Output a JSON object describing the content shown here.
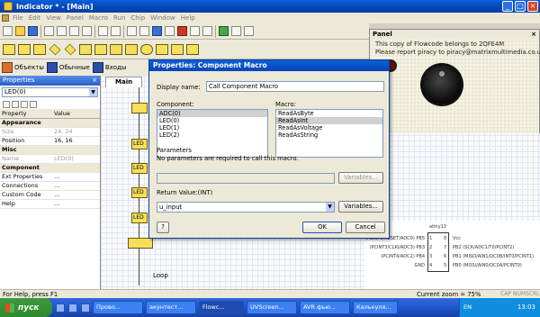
{
  "window": {
    "title": "Indicator * - [Main]"
  },
  "menu": [
    "File",
    "Edit",
    "View",
    "Panel",
    "Macro",
    "Run",
    "Chip",
    "Window",
    "Help"
  ],
  "toolbar3": {
    "objects": "Объекты",
    "common": "Обычные",
    "inputs": "Входы"
  },
  "properties": {
    "title": "Properties",
    "selected": "LED(0)",
    "col_property": "Property",
    "col_value": "Value",
    "rows": [
      {
        "type": "cat",
        "k": "Appearance",
        "v": ""
      },
      {
        "type": "dim",
        "k": "Size",
        "v": "24, 24"
      },
      {
        "type": "norm",
        "k": "Position",
        "v": "16, 16"
      },
      {
        "type": "cat",
        "k": "Misc",
        "v": ""
      },
      {
        "type": "dim",
        "k": "Name",
        "v": "LED(0)"
      },
      {
        "type": "cat",
        "k": "Component",
        "v": ""
      },
      {
        "type": "norm",
        "k": "Ext Properties",
        "v": "..."
      },
      {
        "type": "norm",
        "k": "Connections",
        "v": "..."
      },
      {
        "type": "norm",
        "k": "Custom Code",
        "v": "..."
      },
      {
        "type": "norm",
        "k": "Help",
        "v": "..."
      }
    ]
  },
  "workspace": {
    "tab": "Main",
    "loop_label": "Loop",
    "blocks": [
      "LED",
      "LED",
      "LED",
      "LED"
    ]
  },
  "panel": {
    "title": "Panel",
    "line1": "This copy of Flowcode belongs to 2QFE4M",
    "line2": "Please report piracy to piracy@matrixmultimedia.co.uk"
  },
  "chip": {
    "name": "atiny13",
    "left_pins": [
      "(PCINT5/RESET/ADC0) PB5",
      "(PCINT3/CLKI/ADC3) PB3",
      "(PCINT4/ADC2) PB4",
      "GND"
    ],
    "right_pins": [
      "Vcc",
      "PB2 (SCK/ADC1/T0/PCINT2)",
      "PB1 (MISO/AIN1/OC0B/INT0/PCINT1)",
      "PB0 (MOSI/AIN0/OC0A/PCINT0)"
    ],
    "left_nums": [
      "1",
      "2",
      "3",
      "4"
    ],
    "right_nums": [
      "8",
      "7",
      "6",
      "5"
    ]
  },
  "dialog": {
    "title": "Properties: Component Macro",
    "display_name_label": "Display name:",
    "display_name_value": "Call Component Macro",
    "component_label": "Component:",
    "components": [
      "ADC(0)",
      "LED(0)",
      "LED(1)",
      "LED(2)"
    ],
    "component_selected_index": 0,
    "macro_label": "Macro:",
    "macros": [
      "ReadAsByte",
      "ReadAsInt",
      "ReadAsVoltage",
      "ReadAsString"
    ],
    "macro_selected_index": 1,
    "parameters_label": "Parameters",
    "parameters_note": "No parameters are required to call this macro.",
    "variables_button_disabled": "Variables...",
    "return_label": "Return Value:(INT)",
    "return_value": "u_input",
    "variables_button": "Variables...",
    "help_button": "?",
    "ok_button": "OK",
    "cancel_button": "Cancel"
  },
  "status": {
    "help": "For Help, press F1",
    "zoom": "Current zoom = 75%",
    "cap": "CAP",
    "num": "NUM",
    "scrl": "SCRL"
  },
  "taskbar": {
    "start": "пуск",
    "tasks": [
      "Прово...",
      "акунтест...",
      "Flowc...",
      "UVScreen...",
      "AVR фью...",
      "Калькуля..."
    ],
    "active_index": 2,
    "lang": "EN",
    "clock": "13:03"
  }
}
